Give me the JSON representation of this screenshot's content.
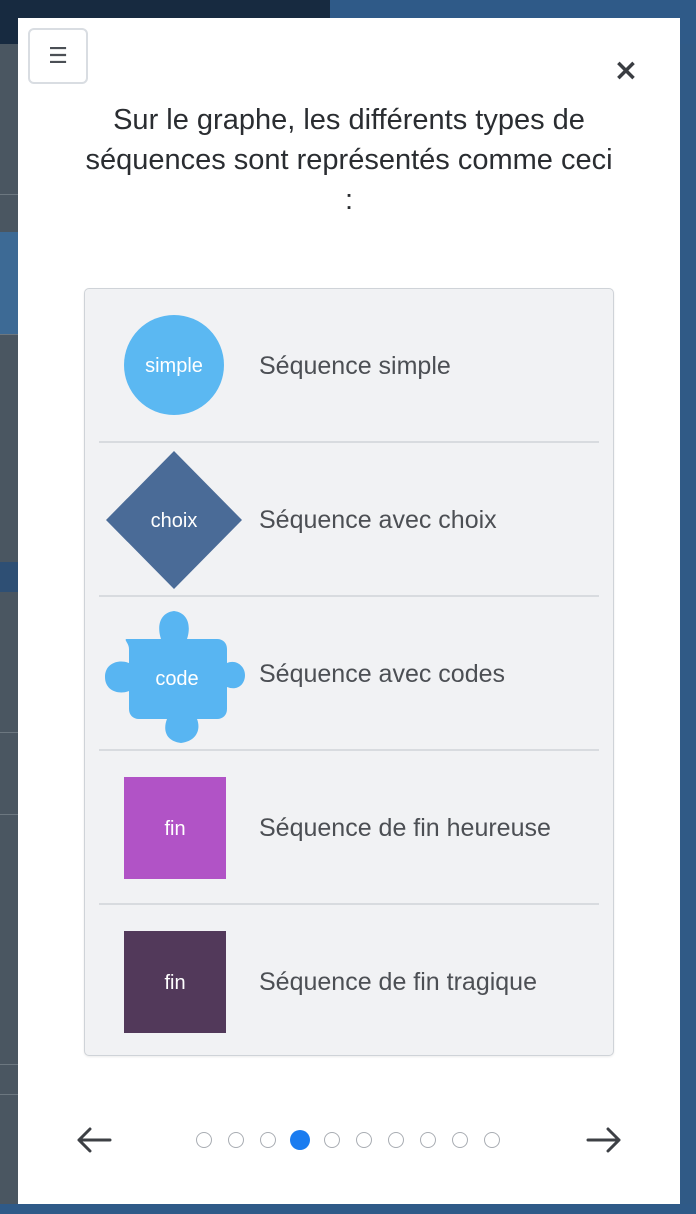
{
  "modal": {
    "menu_icon": "hamburger-icon",
    "menu_glyph": "☰",
    "close_icon": "close-icon",
    "close_glyph": "×",
    "headline": "Sur le graphe, les différents types de séquences sont représentés comme ceci :"
  },
  "legend": [
    {
      "shape": "circle",
      "shape_text": "simple",
      "label": "Séquence simple",
      "color": "#5bb8f2"
    },
    {
      "shape": "diamond",
      "shape_text": "choix",
      "label": "Séquence avec choix",
      "color": "#4a6b97"
    },
    {
      "shape": "puzzle",
      "shape_text": "code",
      "label": "Séquence avec codes",
      "color": "#58b5f2"
    },
    {
      "shape": "square",
      "shape_text": "fin",
      "label": "Séquence de fin heureuse",
      "color": "#b153c6"
    },
    {
      "shape": "square",
      "shape_text": "fin",
      "label": "Séquence de fin tragique",
      "color": "#52395a"
    }
  ],
  "pager": {
    "prev_icon": "arrow-left-icon",
    "next_icon": "arrow-right-icon",
    "total_pages": 10,
    "current_page": 4,
    "active_color": "#1a7cf0"
  }
}
